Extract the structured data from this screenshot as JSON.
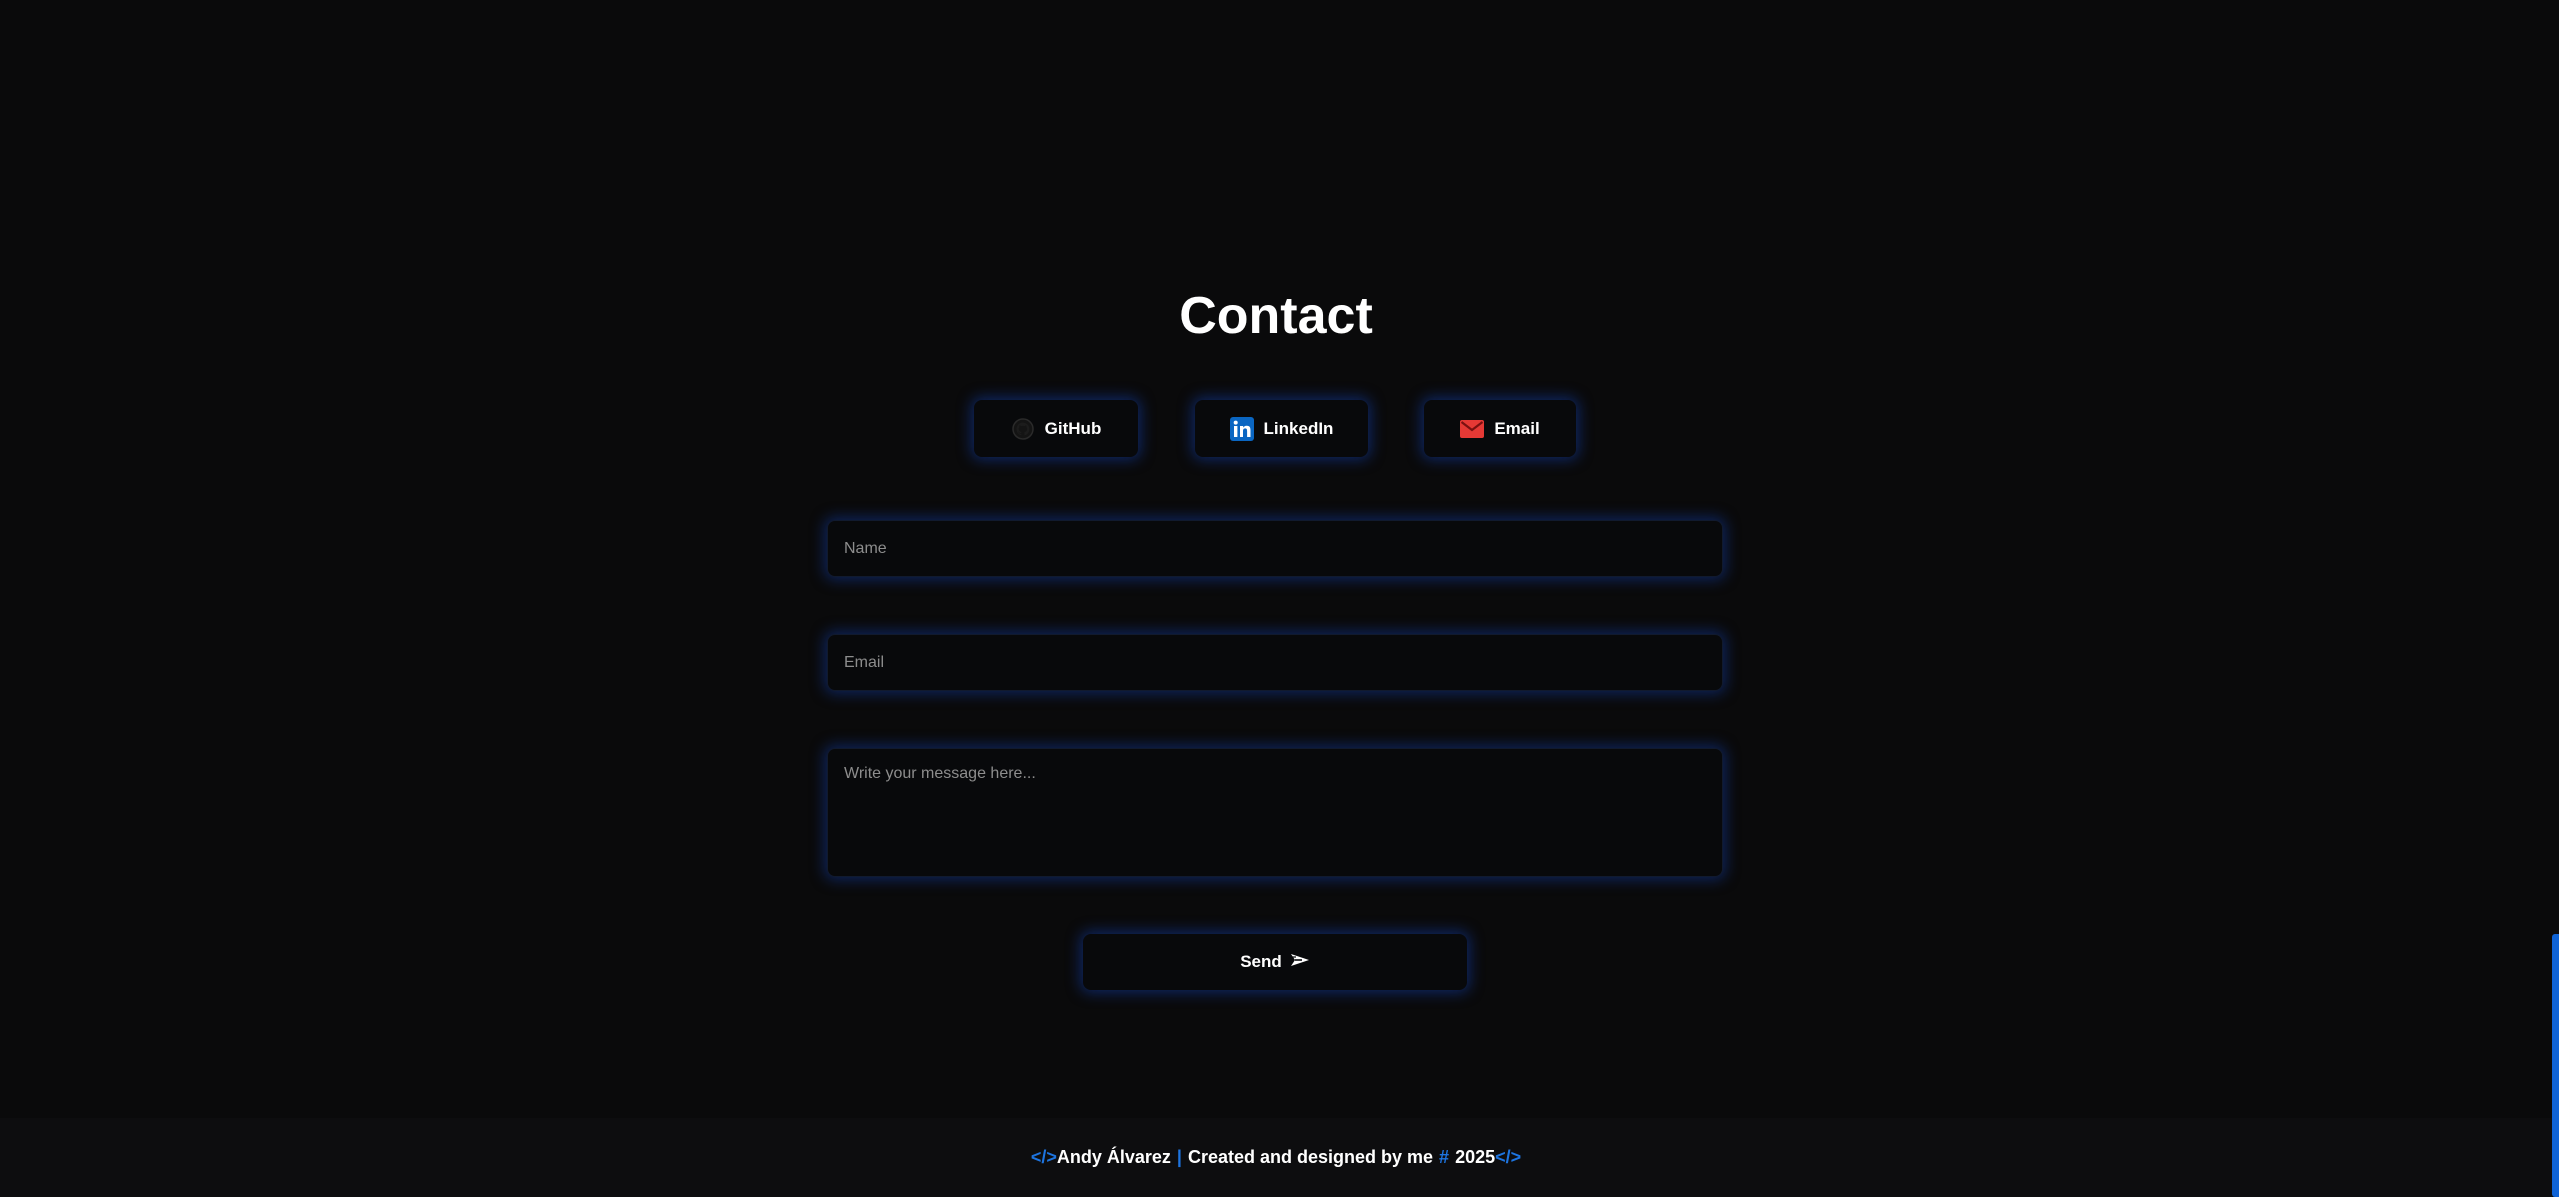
{
  "contact": {
    "title": "Contact"
  },
  "social": [
    {
      "label": "GitHub",
      "icon": "github-icon"
    },
    {
      "label": "LinkedIn",
      "icon": "linkedin-icon"
    },
    {
      "label": "Email",
      "icon": "mail-icon"
    }
  ],
  "form": {
    "name_placeholder": "Name",
    "email_placeholder": "Email",
    "message_placeholder": "Write your message here...",
    "send_label": "Send",
    "send_icon": "paper-plane-icon"
  },
  "footer": {
    "open_tag": "</>",
    "author": "Andy Álvarez",
    "separator": "|",
    "credit": "Created and designed by me",
    "hash": "#",
    "year": "2025",
    "close_tag": "</>"
  },
  "colors": {
    "background": "#0a0a0b",
    "accent": "#1d74e0",
    "glow": "#123eaa",
    "linkedin": "#0a66c2",
    "email": "#e53935"
  }
}
